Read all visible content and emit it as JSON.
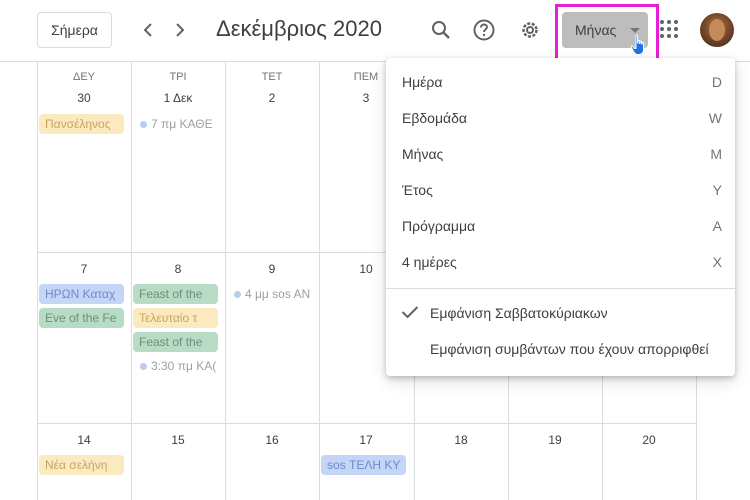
{
  "header": {
    "today_label": "Σήμερα",
    "title": "Δεκέμβριος 2020",
    "view_label": "Μήνας",
    "icons": [
      "chevron-left-icon",
      "chevron-right-icon",
      "search-icon",
      "help-icon",
      "gear-icon",
      "apps-grid-icon"
    ]
  },
  "days_of_week": [
    "ΔΕΥ",
    "ΤΡΙ",
    "ΤΕΤ",
    "ΠΕΜ"
  ],
  "calendar": {
    "week1": [
      "30",
      "1 Δεκ",
      "2",
      "3"
    ],
    "week2": [
      "7",
      "8",
      "9",
      "10"
    ],
    "week3": [
      "14",
      "15",
      "16",
      "17",
      "18",
      "19",
      "20"
    ]
  },
  "events": {
    "full_moon": "Πανσέληνος",
    "tue1_timed": "7 πμ ΚΑΘΕ",
    "heroes": "ΗΡΩΝ Καταχ",
    "eve": "Eve of the Fe",
    "feast1": "Feast of the",
    "last": "Τελευταίο τ",
    "feast2": "Feast of the",
    "tue8_timed": "3:30 πμ ΚΑ(",
    "wed9_timed": "4 μμ sos AN",
    "new_moon": "Νέα σελήνη",
    "taxes": "sos ΤΕΛΗ ΚΥ"
  },
  "view_menu": {
    "items": [
      {
        "label": "Ημέρα",
        "key": "D"
      },
      {
        "label": "Εβδομάδα",
        "key": "W"
      },
      {
        "label": "Μήνας",
        "key": "M"
      },
      {
        "label": "Έτος",
        "key": "Y"
      },
      {
        "label": "Πρόγραμμα",
        "key": "A"
      },
      {
        "label": "4 ημέρες",
        "key": "X"
      }
    ],
    "show_weekends": "Εμφάνιση Σαββατοκύριακων",
    "show_declined": "Εμφάνιση συμβάντων που έχουν απορριφθεί",
    "show_weekends_checked": true
  },
  "colors": {
    "highlight": "#e61fd6",
    "view_button_bg": "#bdbdbd"
  }
}
